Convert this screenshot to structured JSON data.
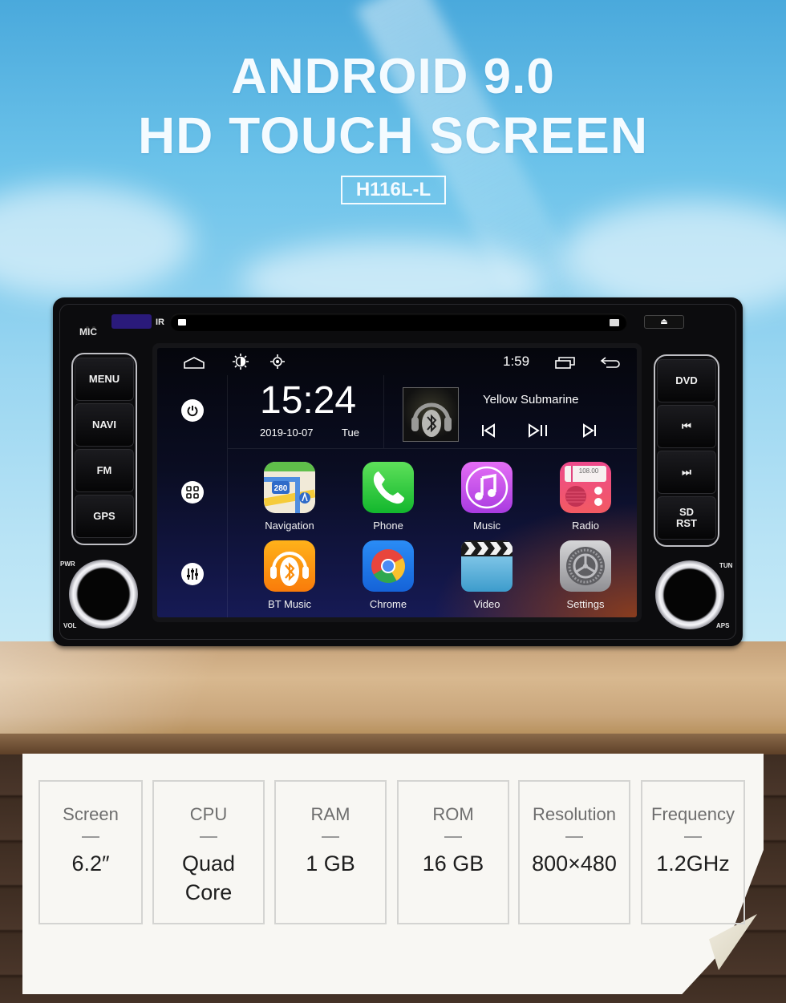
{
  "hero": {
    "title_line1": "ANDROID 9.0",
    "title_line2": "HD TOUCH SCREEN",
    "model": "H116L-L"
  },
  "head_unit": {
    "labels": {
      "mic": "MIC",
      "ir": "IR",
      "pwr": "PWR",
      "vol": "VOL",
      "tun": "TUN",
      "aps": "APS"
    },
    "eject_symbol": "⏏",
    "left_buttons": [
      {
        "label": "MENU"
      },
      {
        "label": "NAVI"
      },
      {
        "label": "FM"
      },
      {
        "label": "GPS"
      }
    ],
    "right_buttons": [
      {
        "label": "DVD"
      },
      {
        "label": "⏮"
      },
      {
        "label": "⏭"
      },
      {
        "label": "SD\nRST"
      }
    ]
  },
  "screen": {
    "status_bar": {
      "icons": [
        "home-icon",
        "brightness-icon",
        "location-icon",
        "recents-icon",
        "back-icon"
      ],
      "time": "1:59"
    },
    "sidebar": {
      "buttons": [
        "power-icon",
        "apps-grid-icon",
        "equalizer-icon"
      ]
    },
    "clock_widget": {
      "time": "15:24",
      "date": "2019-10-07",
      "day": "Tue"
    },
    "music_widget": {
      "song": "Yellow Submarine",
      "controls": [
        "previous-icon",
        "play-pause-icon",
        "next-icon"
      ]
    },
    "apps": [
      {
        "name": "Navigation",
        "icon": "navigation-icon"
      },
      {
        "name": "Phone",
        "icon": "phone-icon"
      },
      {
        "name": "Music",
        "icon": "music-icon"
      },
      {
        "name": "Radio",
        "icon": "radio-icon",
        "frequency": "108.00"
      },
      {
        "name": "BT Music",
        "icon": "bt-music-icon"
      },
      {
        "name": "Chrome",
        "icon": "chrome-icon"
      },
      {
        "name": "Video",
        "icon": "video-icon"
      },
      {
        "name": "Settings",
        "icon": "settings-icon"
      }
    ],
    "nav_icon_shield": "280"
  },
  "specs": [
    {
      "label": "Screen",
      "value": "6.2″"
    },
    {
      "label": "CPU",
      "value": "Quad\nCore"
    },
    {
      "label": "RAM",
      "value": "1 GB"
    },
    {
      "label": "ROM",
      "value": "16 GB"
    },
    {
      "label": "Resolution",
      "value": "800×480"
    },
    {
      "label": "Frequency",
      "value": "1.2GHz"
    }
  ],
  "spec_separator": "—"
}
